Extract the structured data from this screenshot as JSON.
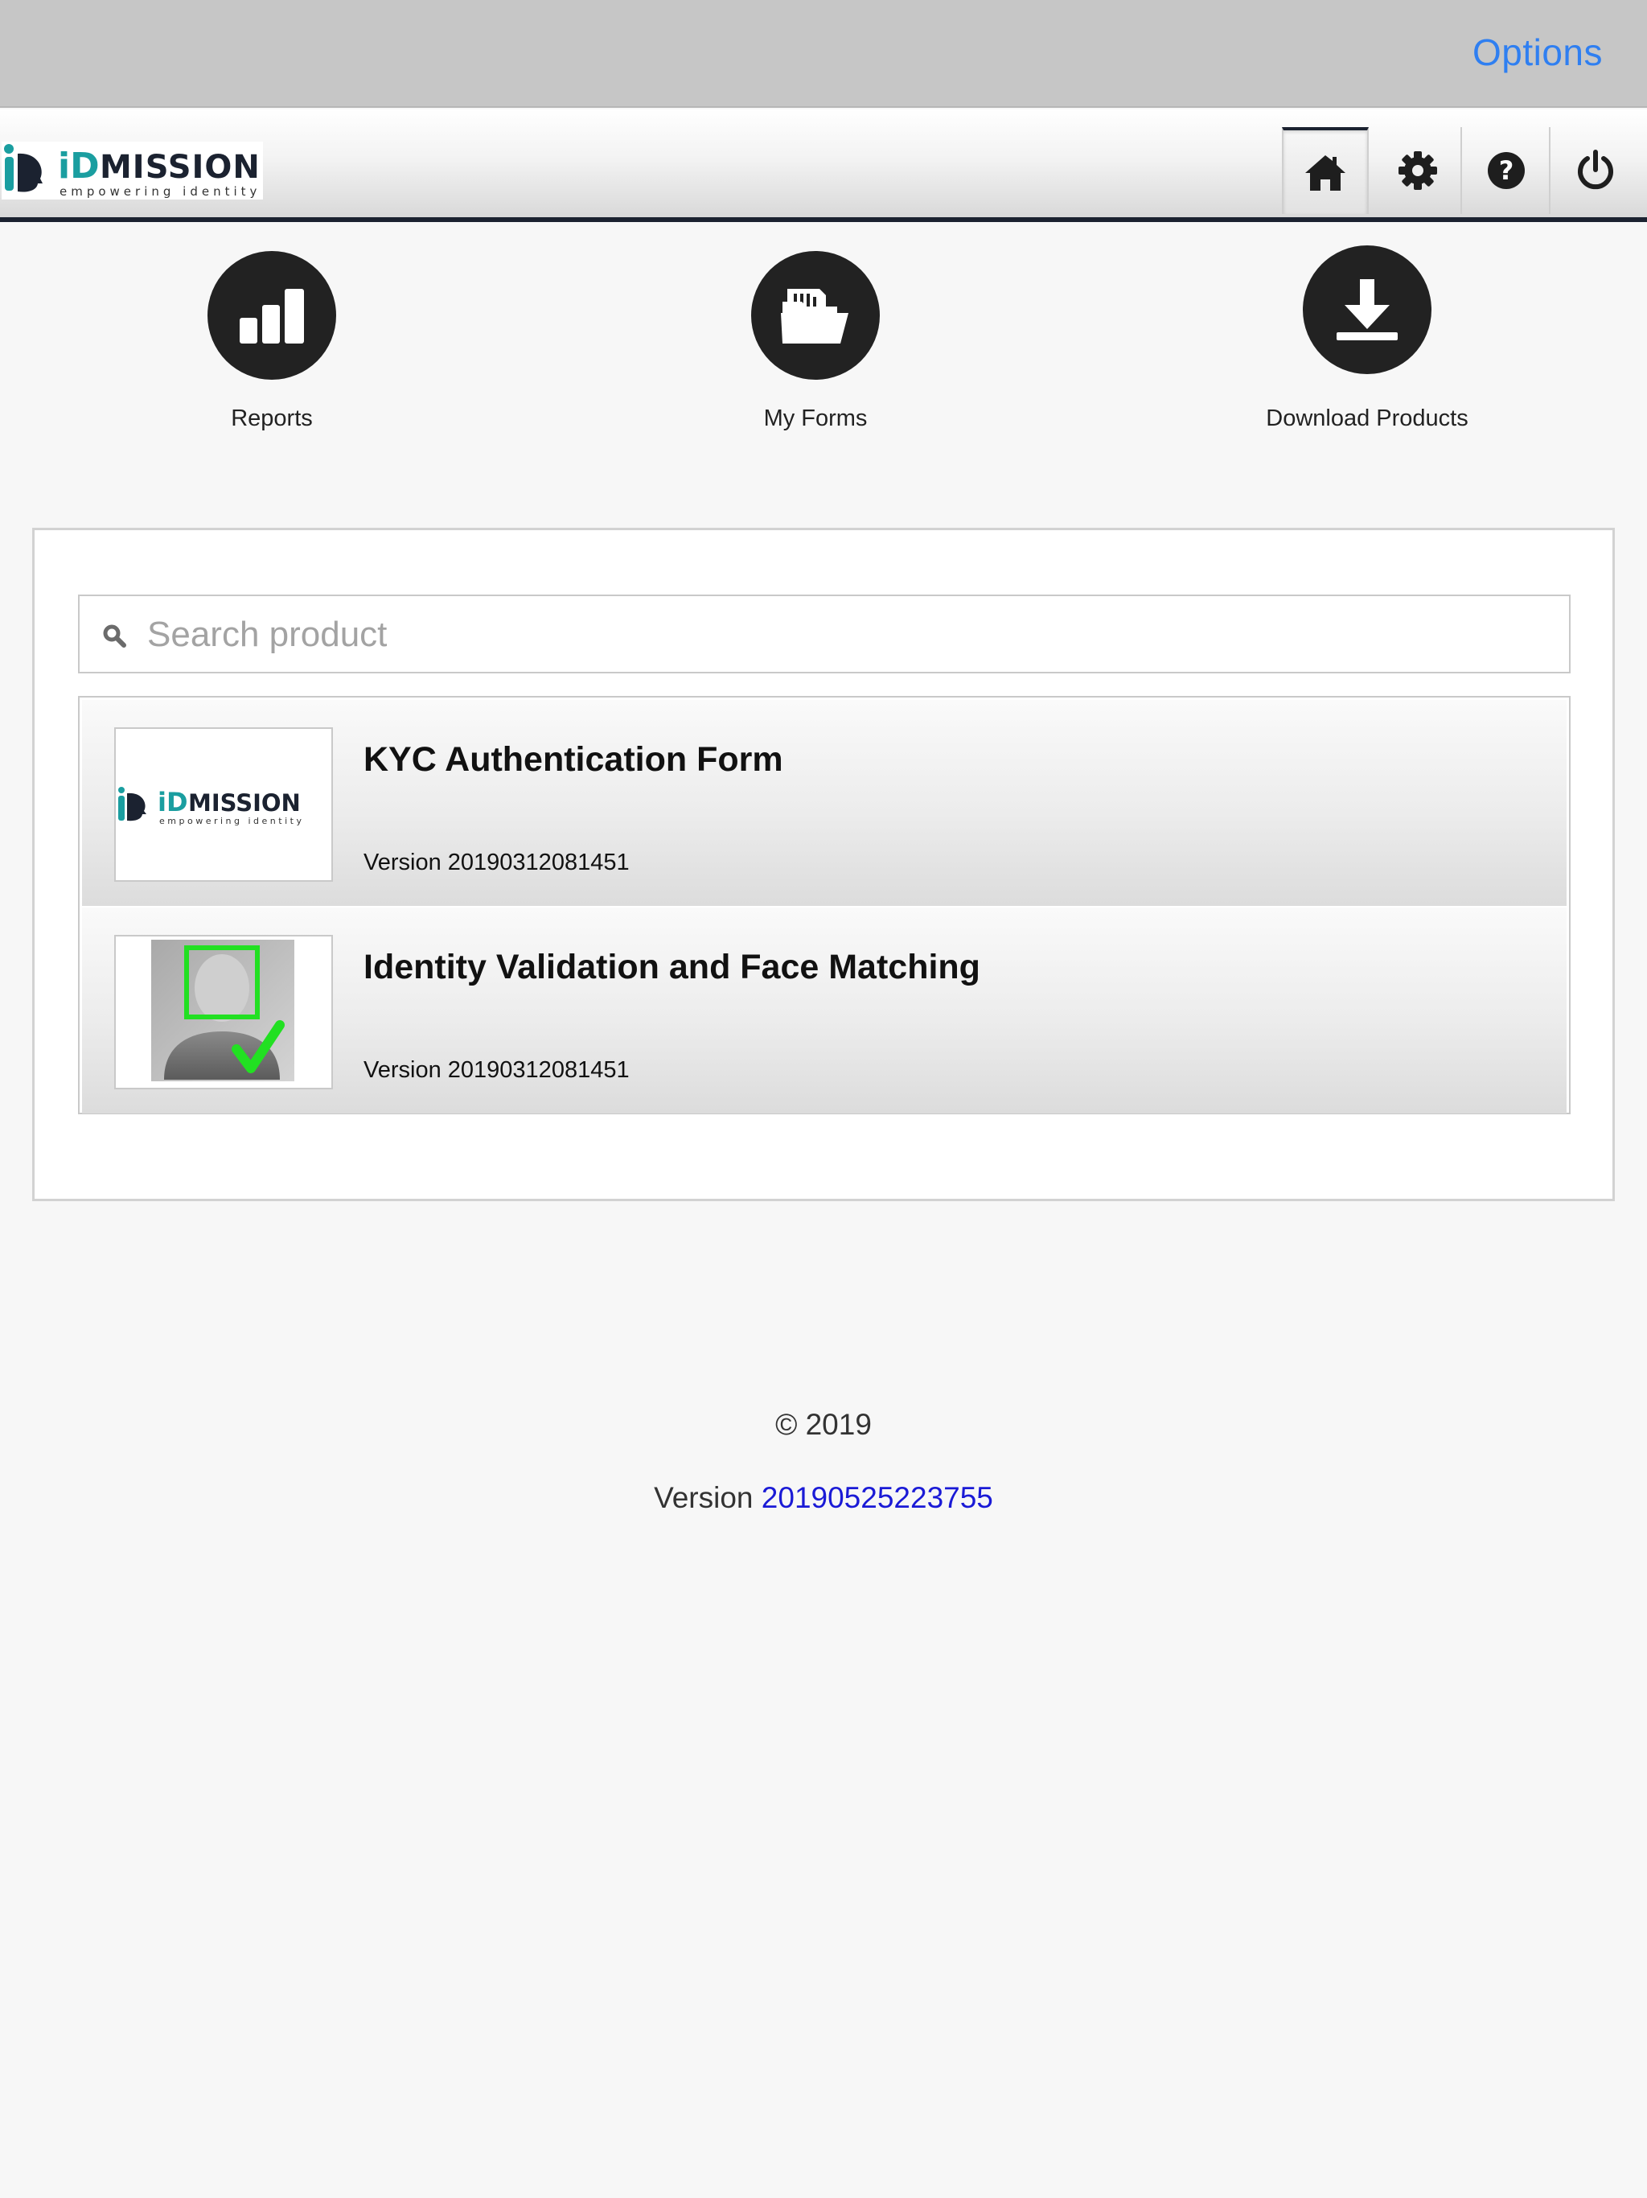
{
  "system_bar": {
    "options_label": "Options"
  },
  "header": {
    "logo": {
      "brand": "iDmission",
      "tagline": "empowering identity"
    },
    "nav": [
      {
        "id": "home",
        "icon": "home-icon",
        "active": true
      },
      {
        "id": "settings",
        "icon": "gear-icon",
        "active": false
      },
      {
        "id": "help",
        "icon": "question-icon",
        "active": false
      },
      {
        "id": "logout",
        "icon": "power-icon",
        "active": false
      }
    ]
  },
  "actions": [
    {
      "label": "Reports",
      "icon": "bar-chart-icon"
    },
    {
      "label": "My Forms",
      "icon": "folder-documents-icon"
    },
    {
      "label": "Download Products",
      "icon": "download-icon"
    }
  ],
  "search": {
    "placeholder": "Search product",
    "value": ""
  },
  "products": [
    {
      "title": "KYC Authentication Form",
      "version": "Version 20190312081451",
      "thumbnail": "idmission-logo"
    },
    {
      "title": "Identity Validation and Face Matching",
      "version": "Version 20190312081451",
      "thumbnail": "face-match-image"
    }
  ],
  "footer": {
    "copyright": "© 2019",
    "version_label": "Version",
    "version_number": "20190525223755"
  },
  "colors": {
    "accent_blue": "#2f7ff1",
    "link_blue": "#1a1ad6",
    "brand_teal": "#1a9ea0",
    "dark": "#222222",
    "header_rule": "#1b2230",
    "face_box_green": "#22e022"
  }
}
